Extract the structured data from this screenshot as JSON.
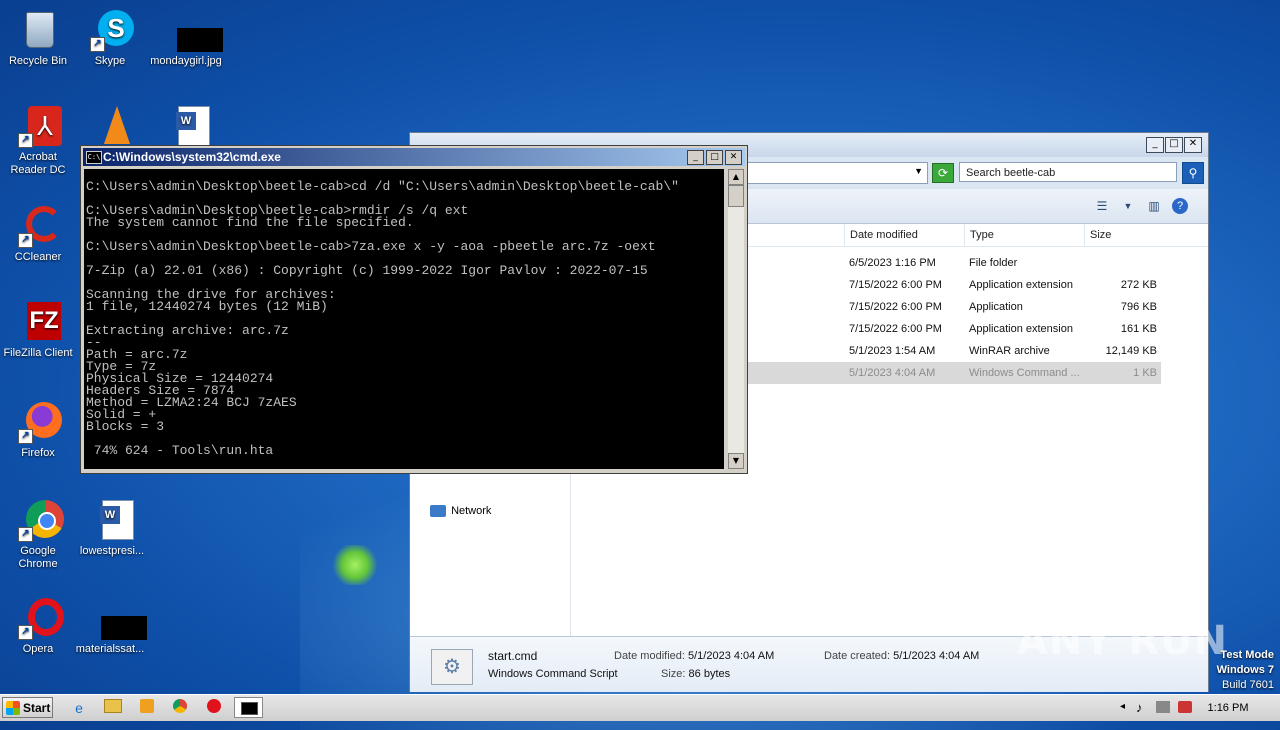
{
  "desktop_icons": [
    {
      "label": "Recycle Bin",
      "icon": "recycle-bin-icon"
    },
    {
      "label": "Skype",
      "icon": "skype-icon"
    },
    {
      "label": "mondaygirl.jpg",
      "icon": "image-file-icon"
    },
    {
      "label": "Acrobat Reader DC",
      "icon": "acrobat-icon"
    },
    {
      "label": "CCleaner",
      "icon": "ccleaner-icon"
    },
    {
      "label": "FileZilla Client",
      "icon": "filezilla-icon"
    },
    {
      "label": "Firefox",
      "icon": "firefox-icon"
    },
    {
      "label": "Google Chrome",
      "icon": "chrome-icon"
    },
    {
      "label": "lowestpresi...",
      "icon": "word-document-icon"
    },
    {
      "label": "Opera",
      "icon": "opera-icon"
    },
    {
      "label": "materialssat...",
      "icon": "image-file-icon"
    }
  ],
  "cmd": {
    "title": "C:\\Windows\\system32\\cmd.exe",
    "lines": [
      "C:\\Users\\admin\\Desktop\\beetle-cab>cd /d \"C:\\Users\\admin\\Desktop\\beetle-cab\\\"",
      "",
      "C:\\Users\\admin\\Desktop\\beetle-cab>rmdir /s /q ext",
      "The system cannot find the file specified.",
      "",
      "C:\\Users\\admin\\Desktop\\beetle-cab>7za.exe x -y -aoa -pbeetle arc.7z -oext",
      "",
      "7-Zip (a) 22.01 (x86) : Copyright (c) 1999-2022 Igor Pavlov : 2022-07-15",
      "",
      "Scanning the drive for archives:",
      "1 file, 12440274 bytes (12 MiB)",
      "",
      "Extracting archive: arc.7z",
      "--",
      "Path = arc.7z",
      "Type = 7z",
      "Physical Size = 12440274",
      "Headers Size = 7874",
      "Method = LZMA2:24 BCJ 7zAES",
      "Solid = +",
      "Blocks = 3",
      "",
      " 74% 624 - Tools\\run.hta"
    ]
  },
  "explorer": {
    "search_placeholder": "Search beetle-cab",
    "columns": [
      "Date modified",
      "Type",
      "Size"
    ],
    "rows": [
      {
        "date": "6/5/2023 1:16 PM",
        "type": "File folder",
        "size": ""
      },
      {
        "date": "7/15/2022 6:00 PM",
        "type": "Application extension",
        "size": "272 KB"
      },
      {
        "date": "7/15/2022 6:00 PM",
        "type": "Application",
        "size": "796 KB"
      },
      {
        "date": "7/15/2022 6:00 PM",
        "type": "Application extension",
        "size": "161 KB"
      },
      {
        "date": "5/1/2023 1:54 AM",
        "type": "WinRAR archive",
        "size": "12,149 KB"
      },
      {
        "date": "5/1/2023 4:04 AM",
        "type": "Windows Command ...",
        "size": "1 KB"
      }
    ],
    "nav_network": "Network",
    "details": {
      "name": "start.cmd",
      "type": "Windows Command Script",
      "modified_label": "Date modified:",
      "modified": "5/1/2023 4:04 AM",
      "size_label": "Size:",
      "size": "86 bytes",
      "created_label": "Date created:",
      "created": "5/1/2023 4:04 AM"
    }
  },
  "taskbar": {
    "start_label": "Start",
    "clock": "1:16 PM"
  },
  "watermark": "ANY RUN",
  "test_mode": {
    "line1": "Test Mode",
    "line2": "Windows 7",
    "line3": "Build 7601"
  }
}
